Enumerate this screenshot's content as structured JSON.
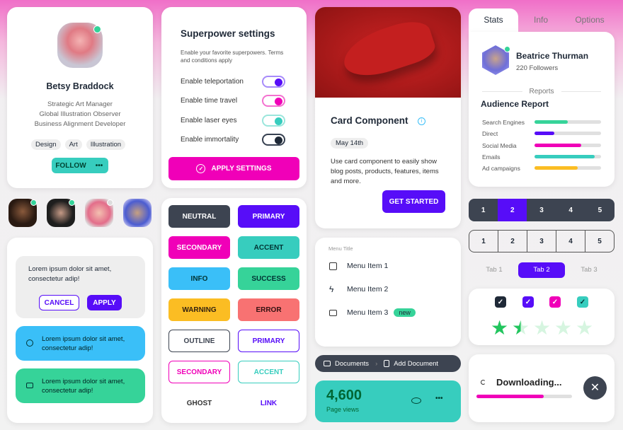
{
  "profile": {
    "name": "Betsy Braddock",
    "roles": [
      "Strategic Art Manager",
      "Global Illustration Observer",
      "Business Alignment Developer"
    ],
    "tags": [
      "Design",
      "Art",
      "Illustration"
    ],
    "follow_label": "FOLLOW",
    "more_label": "•••",
    "online": true
  },
  "avatars": [
    {
      "online": true
    },
    {
      "online": true
    },
    {
      "online": false
    },
    {
      "online": false
    }
  ],
  "alerts": {
    "card_text": "Lorem ipsum dolor sit amet, consectetur adip!",
    "cancel_label": "CANCEL",
    "apply_label": "APPLY",
    "info_text": "Lorem ipsum dolor sit amet, consectetur adip!",
    "success_text": "Lorem ipsum dolor sit amet, consectetur adip!"
  },
  "settings": {
    "title": "Superpower settings",
    "description": "Enable your favorite superpowers. Terms and conditions apply",
    "toggles": [
      {
        "label": "Enable teleportation",
        "on": true,
        "color": "#570df8"
      },
      {
        "label": "Enable time travel",
        "on": true,
        "color": "#f000b8"
      },
      {
        "label": "Enable laser eyes",
        "on": true,
        "color": "#37cdbe"
      },
      {
        "label": "Enable immortality",
        "on": true,
        "color": "#1f2937"
      }
    ],
    "apply_label": "APPLY SETTINGS"
  },
  "buttons": [
    [
      "NEUTRAL",
      "PRIMARY"
    ],
    [
      "SECONDARY",
      "ACCENT"
    ],
    [
      "INFO",
      "SUCCESS"
    ],
    [
      "WARNING",
      "ERROR"
    ],
    [
      "OUTLINE",
      "PRIMARY"
    ],
    [
      "SECONDARY",
      "ACCENT"
    ],
    [
      "GHOST",
      "LINK"
    ]
  ],
  "product": {
    "title": "Card Component",
    "date": "May 14th",
    "text": "Use card component to easily show blog posts, products, features, items and more.",
    "cta": "GET STARTED"
  },
  "menu": {
    "title": "Menu Title",
    "items": [
      {
        "label": "Menu Item 1",
        "icon": "document-icon"
      },
      {
        "label": "Menu Item 2",
        "icon": "bolt-icon"
      },
      {
        "label": "Menu Item 3",
        "icon": "folder-icon",
        "badge": "new"
      }
    ]
  },
  "breadcrumb": [
    "Documents",
    "Add Document"
  ],
  "stat": {
    "value": "4,600",
    "label": "Page views"
  },
  "tabs": {
    "items": [
      "Stats",
      "Info",
      "Options"
    ],
    "active": "Stats"
  },
  "user": {
    "name": "Beatrice Thurman",
    "followers": "220 Followers",
    "online": true
  },
  "report": {
    "divider": "Reports",
    "title": "Audience Report",
    "rows": [
      {
        "label": "Search Engines",
        "value": 50,
        "color": "#36d399"
      },
      {
        "label": "Direct",
        "value": 30,
        "color": "#570df8"
      },
      {
        "label": "Social Media",
        "value": 70,
        "color": "#f000b8"
      },
      {
        "label": "Emails",
        "value": 90,
        "color": "#37cdbe"
      },
      {
        "label": "Ad campaigns",
        "value": 65,
        "color": "#fbbd23"
      }
    ]
  },
  "pagination": {
    "pages": [
      "1",
      "2",
      "3",
      "4",
      "5"
    ],
    "active": "2"
  },
  "pagination_outline": {
    "pages": [
      "1",
      "2",
      "3",
      "4",
      "5"
    ]
  },
  "boxed_tabs": {
    "items": [
      "Tab 1",
      "Tab 2",
      "Tab 3"
    ],
    "active": "Tab 2"
  },
  "checkboxes": [
    {
      "checked": true,
      "color": "#1f2937"
    },
    {
      "checked": true,
      "color": "#570df8"
    },
    {
      "checked": true,
      "color": "#f000b8"
    },
    {
      "checked": true,
      "color": "#37cdbe"
    }
  ],
  "rating": {
    "value": 1.5,
    "max": 5
  },
  "download": {
    "label": "Downloading...",
    "progress": 70
  }
}
